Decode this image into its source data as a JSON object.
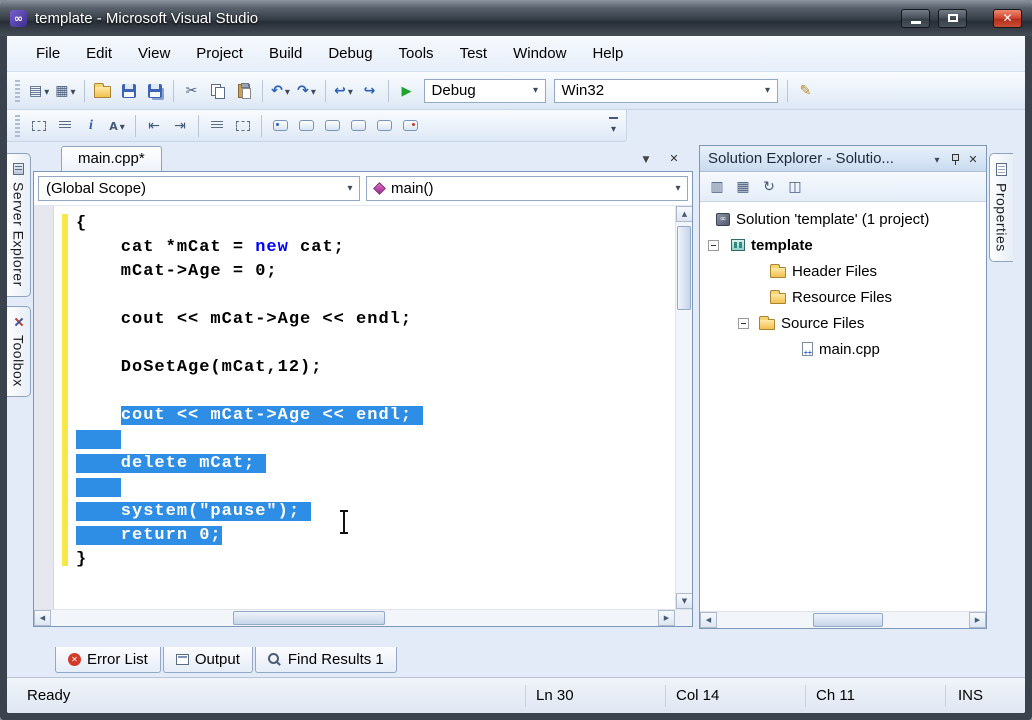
{
  "colors": {
    "selection_blue": "#2E8DE5",
    "keyword_blue": "#0000FF",
    "change_bar_yellow": "#F7E84A",
    "close_button_red": "#C43C2C",
    "title_bar_dark": "#39424D"
  },
  "window": {
    "title": "template - Microsoft Visual Studio"
  },
  "menu_bar": {
    "items": [
      "File",
      "Edit",
      "View",
      "Project",
      "Build",
      "Debug",
      "Tools",
      "Test",
      "Window",
      "Help"
    ]
  },
  "standard_toolbar": {
    "debug_combo": "Debug",
    "platform_combo": "Win32",
    "icon_names": [
      "new-project",
      "add-new-item",
      "open-file",
      "save",
      "save-all",
      "cut",
      "copy",
      "paste",
      "undo",
      "redo",
      "navigate-backward",
      "navigate-forward",
      "start-debugging",
      "find-in-files"
    ]
  },
  "text_editor_toolbar": {
    "icon_names": [
      "display-member-list",
      "parameter-info",
      "quick-info",
      "word-completion",
      "decrease-indent",
      "increase-indent",
      "comment-selection",
      "uncomment-selection",
      "toggle-bookmark",
      "previous-bookmark",
      "next-bookmark",
      "previous-bookmark-in-folder",
      "next-bookmark-in-folder",
      "clear-bookmarks"
    ]
  },
  "left_tabs": [
    {
      "label": "Server Explorer"
    },
    {
      "label": "Toolbox"
    }
  ],
  "right_tabs": [
    {
      "label": "Properties"
    }
  ],
  "editor": {
    "tab_label": "main.cpp*",
    "scope_dropdown": "(Global Scope)",
    "member_dropdown": "main()",
    "code_lines": [
      {
        "segments": [
          {
            "text": "{",
            "style": "plain"
          }
        ]
      },
      {
        "segments": [
          {
            "text": "    cat *mCat = ",
            "style": "plain"
          },
          {
            "text": "new",
            "style": "keyword"
          },
          {
            "text": " cat;",
            "style": "plain"
          }
        ]
      },
      {
        "segments": [
          {
            "text": "    mCat->Age = 0;",
            "style": "plain"
          }
        ]
      },
      {
        "segments": []
      },
      {
        "segments": [
          {
            "text": "    cout << mCat->Age << endl;",
            "style": "plain"
          }
        ]
      },
      {
        "segments": []
      },
      {
        "segments": [
          {
            "text": "    DoSetAge(mCat,12);",
            "style": "plain"
          }
        ]
      },
      {
        "segments": []
      },
      {
        "segments": [
          {
            "text": "    ",
            "style": "plain"
          },
          {
            "text": "cout << mCat->Age << endl; ",
            "style": "selected"
          }
        ]
      },
      {
        "segments": [
          {
            "text": "    ",
            "style": "selected"
          }
        ]
      },
      {
        "segments": [
          {
            "text": "    delete mCat; ",
            "style": "selected"
          }
        ]
      },
      {
        "segments": [
          {
            "text": "    ",
            "style": "selected"
          }
        ]
      },
      {
        "segments": [
          {
            "text": "    system(\"pause\"); ",
            "style": "selected"
          }
        ]
      },
      {
        "segments": [
          {
            "text": "    return 0;",
            "style": "selected"
          }
        ]
      },
      {
        "segments": [
          {
            "text": "}",
            "style": "plain"
          }
        ]
      }
    ]
  },
  "solution_explorer": {
    "title": "Solution Explorer - Solutio...",
    "toolbar_icon_names": [
      "properties",
      "show-all-files",
      "refresh",
      "view-class-diagram"
    ],
    "tree": [
      {
        "label": "Solution 'template' (1 project)",
        "icon": "solution"
      },
      {
        "label": "template",
        "icon": "project",
        "bold": true,
        "expanded": true
      },
      {
        "label": "Header Files",
        "icon": "folder"
      },
      {
        "label": "Resource Files",
        "icon": "folder"
      },
      {
        "label": "Source Files",
        "icon": "folder",
        "expanded": true
      },
      {
        "label": "main.cpp",
        "icon": "cpp-file"
      }
    ]
  },
  "bottom_tabs": [
    {
      "label": "Error List"
    },
    {
      "label": "Output"
    },
    {
      "label": "Find Results 1"
    }
  ],
  "status_bar": {
    "message": "Ready",
    "line": "Ln 30",
    "column": "Col 14",
    "character": "Ch 11",
    "insert_mode": "INS"
  }
}
